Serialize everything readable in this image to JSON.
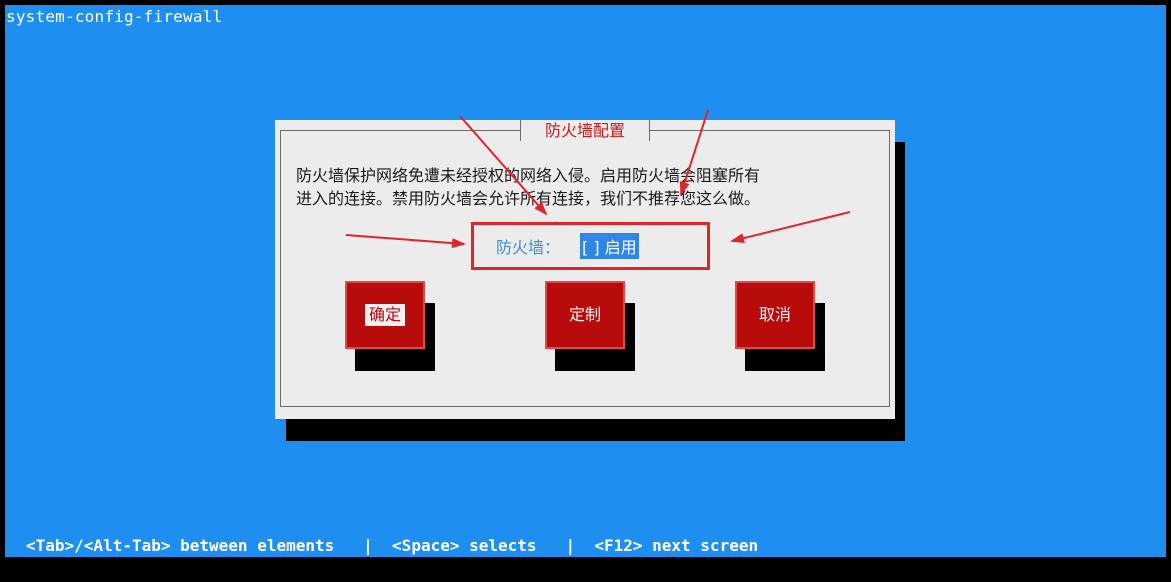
{
  "window": {
    "title": "system-config-firewall"
  },
  "dialog": {
    "title": "防火墙配置",
    "description_line1": "防火墙保护网络免遭未经授权的网络入侵。启用防火墙会阻塞所有",
    "description_line2": "进入的连接。禁用防火墙会允许所有连接，我们不推荐您这么做。",
    "firewall_label": "防火墙：",
    "firewall_toggle": "[ ] 启用",
    "firewall_enabled": false
  },
  "buttons": {
    "ok_label": "确定",
    "customize_label": "定制",
    "cancel_label": "取消"
  },
  "statusbar": {
    "text": "<Tab>/<Alt-Tab> between elements   |  <Space> selects   |  <F12> next screen"
  },
  "colors": {
    "terminal_background": "#1f8ef1",
    "dialog_background": "#ececec",
    "button_red": "#b80b0b",
    "annotation_red": "#e0252a",
    "title_red": "#c81a1a",
    "focus_blue": "#2f86e6"
  }
}
